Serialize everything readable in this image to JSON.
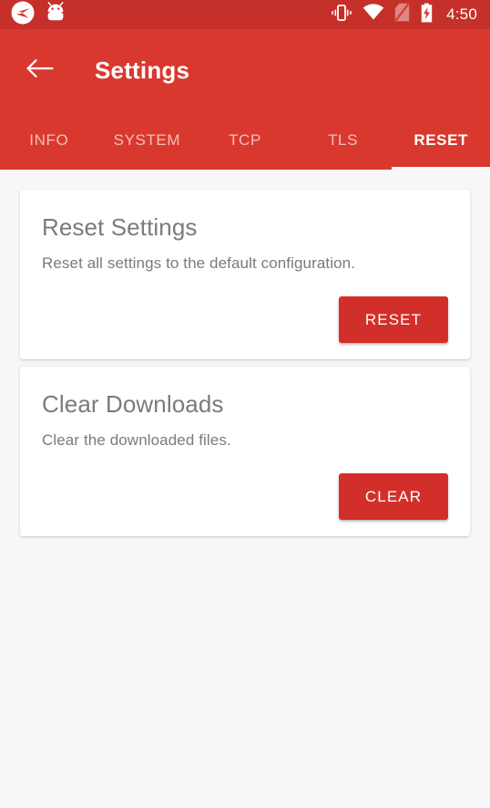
{
  "colors": {
    "status_bar": "#c6302a",
    "app_bar": "#d9382f",
    "accent_button": "#d32f2a",
    "page_background": "#f7f7f9",
    "card_background": "#ffffff",
    "text_gray": "#7b7b7b"
  },
  "status_bar": {
    "left_icons": [
      "app-logo-icon",
      "android-robot-icon"
    ],
    "right_icons": [
      "vibrate-icon",
      "wifi-icon",
      "no-sim-icon",
      "battery-charging-icon"
    ],
    "time": "4:50"
  },
  "app_bar": {
    "back_icon": "arrow-left-icon",
    "title": "Settings"
  },
  "tabs": [
    {
      "label": "INFO",
      "active": false
    },
    {
      "label": "SYSTEM",
      "active": false
    },
    {
      "label": "TCP",
      "active": false
    },
    {
      "label": "TLS",
      "active": false
    },
    {
      "label": "RESET",
      "active": true
    }
  ],
  "cards": [
    {
      "title": "Reset Settings",
      "description": "Reset all settings to the default configuration.",
      "button_label": "RESET"
    },
    {
      "title": "Clear Downloads",
      "description": "Clear the downloaded files.",
      "button_label": "CLEAR"
    }
  ]
}
